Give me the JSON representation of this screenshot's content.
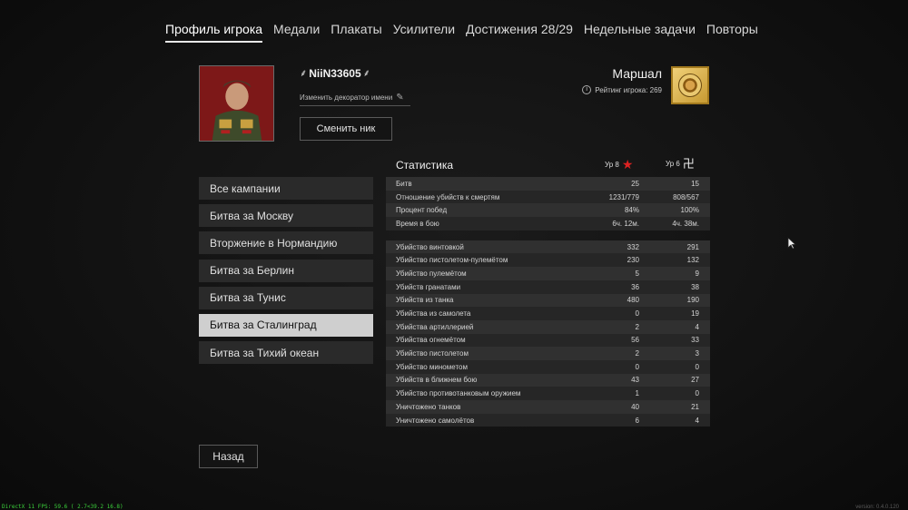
{
  "nav": {
    "tabs": [
      {
        "label": "Профиль игрока",
        "active": true
      },
      {
        "label": "Медали"
      },
      {
        "label": "Плакаты"
      },
      {
        "label": "Усилители"
      },
      {
        "label": "Достижения 28/29"
      },
      {
        "label": "Недельные задачи"
      },
      {
        "label": "Повторы"
      }
    ]
  },
  "profile": {
    "nickname": "NiiN33605",
    "decor_left": "⸙",
    "decor_right": "⸙",
    "change_decorator": "Изменить декоратор имени",
    "change_nick_button": "Сменить ник",
    "rank": "Маршал",
    "rating_label": "Рейтинг игрока: 269"
  },
  "campaigns": {
    "items": [
      "Все кампании",
      "Битва за Москву",
      "Вторжение в Нормандию",
      "Битва за Берлин",
      "Битва за Тунис",
      "Битва за Сталинград",
      "Битва за Тихий океан"
    ],
    "active_index": 5
  },
  "back_button": "Назад",
  "stats": {
    "title": "Статистика",
    "col1": "Ур 8",
    "col2": "Ур 6",
    "general": [
      [
        "Битв",
        "25",
        "15"
      ],
      [
        "Отношение убийств к смертям",
        "1231/779",
        "808/567"
      ],
      [
        "Процент побед",
        "84%",
        "100%"
      ],
      [
        "Время в бою",
        "6ч. 12м.",
        "4ч. 38м."
      ]
    ],
    "kills": [
      [
        "Убийство винтовкой",
        "332",
        "291"
      ],
      [
        "Убийство пистолетом-пулемётом",
        "230",
        "132"
      ],
      [
        "Убийство пулемётом",
        "5",
        "9"
      ],
      [
        "Убийств гранатами",
        "36",
        "38"
      ],
      [
        "Убийств из танка",
        "480",
        "190"
      ],
      [
        "Убийства из самолета",
        "0",
        "19"
      ],
      [
        "Убийства артиллерией",
        "2",
        "4"
      ],
      [
        "Убийства огнемётом",
        "56",
        "33"
      ],
      [
        "Убийство пистолетом",
        "2",
        "3"
      ],
      [
        "Убийство минометом",
        "0",
        "0"
      ],
      [
        "Убийств в ближнем бою",
        "43",
        "27"
      ],
      [
        "Убийство противотанковым оружием",
        "1",
        "0"
      ],
      [
        "Уничтожено танков",
        "40",
        "21"
      ],
      [
        "Уничтожено самолётов",
        "6",
        "4"
      ]
    ]
  },
  "footer": {
    "fps": "DirectX 11 FPS: 59.6 ( 2.7<39.2 16.8)",
    "version": "version: 0.4.0.120"
  },
  "colors": {
    "active_tab_underline": "#e8e8e8",
    "active_campaign_bg": "#cfcfcf",
    "fps_text": "#3bd13b",
    "star": "#dd2222"
  }
}
